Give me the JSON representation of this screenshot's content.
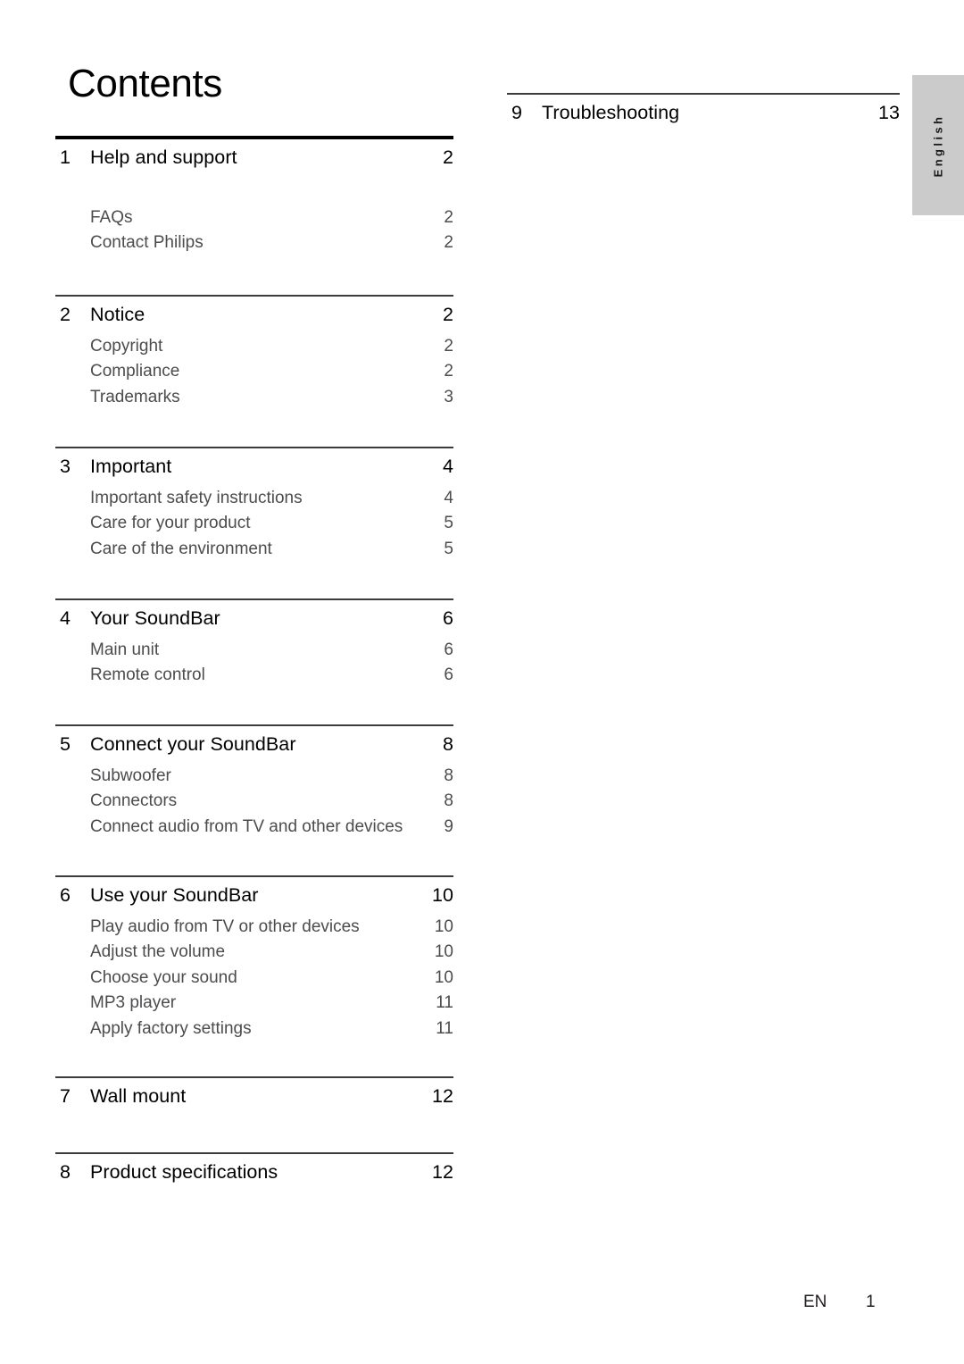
{
  "document": {
    "title": "Contents",
    "language_tab": "English",
    "footer": {
      "language_code": "EN",
      "page_number": "1"
    }
  },
  "toc": {
    "left_column": [
      {
        "rule": "thick",
        "number": "1",
        "title": "Help and support",
        "page": "2",
        "subitems": [
          {
            "label": "FAQs",
            "page": "2"
          },
          {
            "label": "Contact Philips",
            "page": "2"
          }
        ]
      },
      {
        "rule": "thin",
        "number": "2",
        "title": "Notice",
        "page": "2",
        "subitems": [
          {
            "label": "Copyright",
            "page": "2"
          },
          {
            "label": "Compliance",
            "page": "2"
          },
          {
            "label": "Trademarks",
            "page": "3"
          }
        ]
      },
      {
        "rule": "thin",
        "number": "3",
        "title": "Important",
        "page": "4",
        "subitems": [
          {
            "label": "Important safety instructions",
            "page": "4"
          },
          {
            "label": "Care for your product",
            "page": "5"
          },
          {
            "label": "Care of the environment",
            "page": "5"
          }
        ]
      },
      {
        "rule": "thin",
        "number": "4",
        "title": "Your SoundBar",
        "page": "6",
        "subitems": [
          {
            "label": "Main unit",
            "page": "6"
          },
          {
            "label": "Remote control",
            "page": "6"
          }
        ]
      },
      {
        "rule": "thin",
        "number": "5",
        "title": "Connect your SoundBar",
        "page": "8",
        "subitems": [
          {
            "label": "Subwoofer",
            "page": "8"
          },
          {
            "label": "Connectors",
            "page": "8"
          },
          {
            "label": "Connect audio from TV and other devices",
            "page": "9"
          }
        ]
      },
      {
        "rule": "thin",
        "number": "6",
        "title": "Use your SoundBar",
        "page": "10",
        "subitems": [
          {
            "label": "Play audio from TV or other devices",
            "page": "10"
          },
          {
            "label": "Adjust the volume",
            "page": "10"
          },
          {
            "label": "Choose your sound",
            "page": "10"
          },
          {
            "label": "MP3 player",
            "page": "11"
          },
          {
            "label": "Apply factory settings",
            "page": "11"
          }
        ]
      },
      {
        "rule": "thin",
        "number": "7",
        "title": "Wall mount",
        "page": "12",
        "subitems": []
      },
      {
        "rule": "thin",
        "number": "8",
        "title": "Product specifications",
        "page": "12",
        "subitems": []
      }
    ],
    "right_column": [
      {
        "rule": "thin",
        "number": "9",
        "title": "Troubleshooting",
        "page": "13",
        "subitems": []
      }
    ]
  }
}
